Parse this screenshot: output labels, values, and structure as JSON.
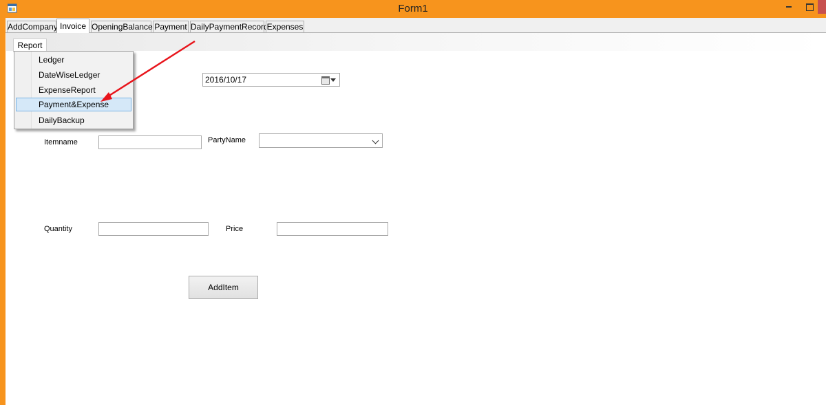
{
  "window": {
    "title": "Form1"
  },
  "tabs": [
    {
      "label": "AddCompany"
    },
    {
      "label": "Invoice"
    },
    {
      "label": "OpeningBalance"
    },
    {
      "label": "Payment"
    },
    {
      "label": "DailyPaymentRecord"
    },
    {
      "label": "Expenses"
    }
  ],
  "active_tab": "Invoice",
  "menu": {
    "report_label": "Report",
    "items": [
      {
        "label": "Ledger"
      },
      {
        "label": "DateWiseLedger"
      },
      {
        "label": "ExpenseReport"
      },
      {
        "label": "Payment&Expense"
      },
      {
        "label": "DailyBackup"
      }
    ],
    "highlighted": "Payment&Expense"
  },
  "form": {
    "date_value": "2016/10/17",
    "itemname_label": "Itemname",
    "itemname_value": "",
    "partyname_label": "PartyName",
    "partyname_value": "",
    "quantity_label": "Quantity",
    "quantity_value": "",
    "price_label": "Price",
    "price_value": "",
    "additem_label": "AddItem"
  },
  "colors": {
    "titlebar": "#f7941d",
    "annotation_arrow": "#e8141b",
    "highlight": "#d5e8f8"
  }
}
